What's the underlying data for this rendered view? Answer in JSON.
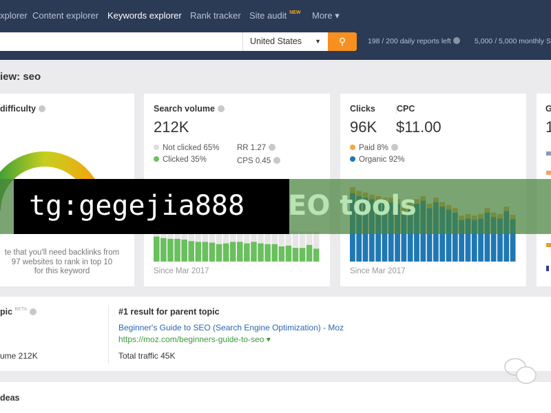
{
  "nav": {
    "items": [
      "xplorer",
      "Content explorer",
      "Keywords explorer",
      "Rank tracker",
      "Site audit",
      "More ▾"
    ],
    "new_badge": "NEW",
    "active": "Keywords explorer"
  },
  "search": {
    "value": "",
    "country": "United States",
    "quota_daily": "198 / 200 daily reports left",
    "quota_monthly": "5,000 / 5,000 monthly S"
  },
  "page_title": "iew: seo",
  "difficulty": {
    "title": "difficulty",
    "note": [
      "te that you'll need backlinks from",
      "97 websites to rank in top 10",
      "for this keyword"
    ]
  },
  "volume": {
    "title": "Search volume",
    "value": "212K",
    "not_clicked": "Not clicked 65%",
    "clicked": "Clicked 35%",
    "rr": "RR 1.27",
    "cps": "CPS 0.45",
    "since": "Since Mar 2017",
    "clicked_bars": [
      33,
      31,
      30,
      30,
      29,
      27,
      26,
      26,
      25,
      23,
      24,
      26,
      26,
      24,
      26,
      24,
      23,
      23,
      20,
      21,
      18,
      18,
      22,
      17
    ]
  },
  "clicks": {
    "title": "Clicks",
    "value": "96K",
    "cpc_title": "CPC",
    "cpc": "$11.00",
    "paid": "Paid 8%",
    "organic": "Organic 92%",
    "since": "Since Mar 2017",
    "organic_bars": [
      92,
      88,
      86,
      84,
      82,
      80,
      80,
      78,
      66,
      74,
      78,
      82,
      72,
      80,
      74,
      70,
      66,
      56,
      58,
      56,
      58,
      66,
      60,
      58,
      68,
      57
    ],
    "paid_bars": [
      8,
      7,
      7,
      6,
      6,
      6,
      6,
      6,
      6,
      6,
      6,
      6,
      6,
      6,
      6,
      6,
      6,
      6,
      6,
      6,
      6,
      6,
      6,
      6,
      6,
      6
    ],
    "colors": {
      "organic": "#1f78b4",
      "paid": "#f5a742",
      "clicked": "#6abf5e",
      "not_clicked": "#e6e6e6"
    }
  },
  "global": {
    "title": "G",
    "value": "1"
  },
  "parent": {
    "title": "pic",
    "beta": "BETA",
    "volume": "ume 212K",
    "result_title": "#1 result for parent topic",
    "link": "Beginner's Guide to SEO (Search Engine Optimization) - Moz",
    "url": "https://moz.com/beginners-guide-to-seo ▾",
    "traffic": "Total traffic 45K"
  },
  "ideas": {
    "title": "deas"
  },
  "watermark": {
    "black": "tg:gegejia888",
    "green": "EO tools"
  }
}
